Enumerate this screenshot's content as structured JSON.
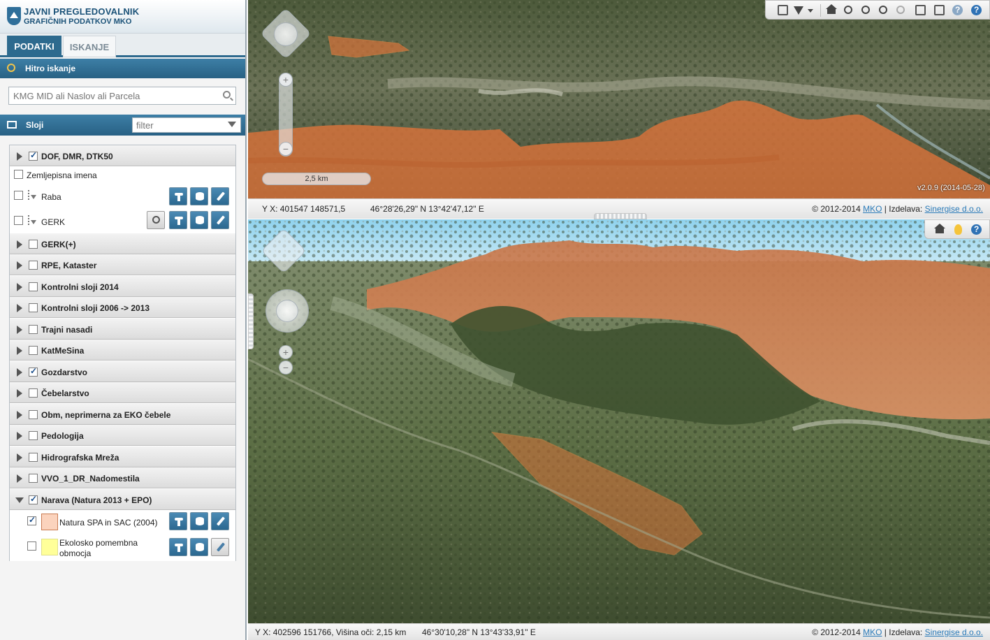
{
  "app": {
    "title_line1": "JAVNI PREGLEDOVALNIK",
    "title_line2": "GRAFIČNIH PODATKOV MKO"
  },
  "tabs": [
    {
      "label": "PODATKI",
      "active": true
    },
    {
      "label": "ISKANJE",
      "active": false
    }
  ],
  "quick_search": {
    "title": "Hitro iskanje",
    "placeholder": "KMG MID ali Naslov ali Parcela"
  },
  "layers_panel": {
    "title": "Sloji",
    "filter_placeholder": "filter"
  },
  "layers": {
    "dof": {
      "label": "DOF, DMR, DTK50",
      "checked": true,
      "expanded": true
    },
    "zemljepisna": {
      "label": "Zemljepisna imena",
      "checked": false
    },
    "raba": {
      "label": "Raba",
      "checked": false
    },
    "gerk": {
      "label": "GERK",
      "checked": false
    },
    "groups": [
      {
        "label": "GERK(+)",
        "checked": false
      },
      {
        "label": "RPE, Kataster",
        "checked": false
      },
      {
        "label": "Kontrolni sloji 2014",
        "checked": false
      },
      {
        "label": "Kontrolni sloji 2006 -> 2013",
        "checked": false
      },
      {
        "label": "Trajni nasadi",
        "checked": false
      },
      {
        "label": "KatMeSina",
        "checked": false
      },
      {
        "label": "Gozdarstvo",
        "checked": true
      },
      {
        "label": "Čebelarstvo",
        "checked": false
      },
      {
        "label": "Obm, neprimerna za EKO čebele",
        "checked": false
      },
      {
        "label": "Pedologija",
        "checked": false
      },
      {
        "label": "Hidrografska Mreža",
        "checked": false
      },
      {
        "label": "VVO_1_DR_Nadomestila",
        "checked": false
      }
    ],
    "narava": {
      "label": "Narava (Natura 2013 + EPO)",
      "checked": true,
      "expanded": true
    },
    "natura": {
      "label": "Natura SPA in SAC (2004)",
      "checked": true,
      "color": "#fbd3bd"
    },
    "ekoloska": {
      "label_line1": "Ekolosko pomembna",
      "label_line2": "obmocja",
      "checked": false,
      "color": "#ffff99"
    }
  },
  "map2d": {
    "scale": "2,5 km",
    "version": "v2.0.9 (2014-05-28)",
    "coords": "Y X: 401547 148571,5",
    "geo": "46°28'26,29\" N 13°42'47,12\" E"
  },
  "map3d": {
    "coords": "Y X: 402596 151766, Višina oči: 2,15 km",
    "geo": "46°30'10,28\" N 13°43'33,91\" E"
  },
  "footer": {
    "copyright": "© 2012-2014",
    "mko": "MKO",
    "izdelava": "| Izdelava:",
    "sinergise": "Sinergise d.o.o."
  },
  "colors": {
    "accent": "#2d6a8e",
    "natura_fill": "#d9733a",
    "link": "#2a7ab8"
  }
}
